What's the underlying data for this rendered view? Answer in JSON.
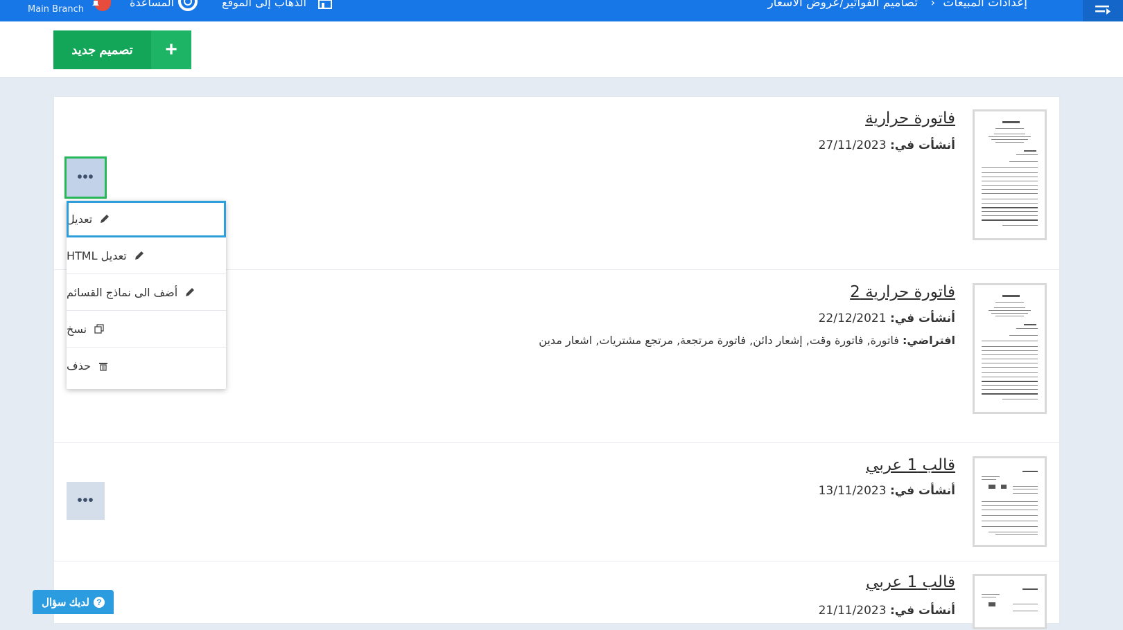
{
  "topbar": {
    "breadcrumb_parent": "إعدادات المبيعات",
    "breadcrumb_separator": "›",
    "breadcrumb_current": "تصاميم الفواتير/عروض الأسعار",
    "visit_site": "الذهاب إلى الموقع",
    "help": "المساعدة",
    "branch": "Main Branch",
    "icons": {
      "menu": "menu-toggle-icon",
      "store": "store-icon",
      "help": "lifebuoy-icon",
      "bell": "bell-icon"
    },
    "color": "#1877e6"
  },
  "actions": {
    "new_design_label": "تصميم جديد",
    "new_design_plus": "+",
    "color": "#13a659"
  },
  "templates": [
    {
      "title": "فاتورة حرارية",
      "created_label": "أنشأت في:",
      "created_date": "27/11/2023",
      "defaults_label": "",
      "defaults": ""
    },
    {
      "title": "فاتورة حرارية 2",
      "created_label": "أنشأت في:",
      "created_date": "22/12/2021",
      "defaults_label": "افتراضي:",
      "defaults": "فاتورة, فاتورة وقت, إشعار دائن, فاتورة مرتجعة, مرتجع مشتريات, اشعار مدين"
    },
    {
      "title": "قالب 1 عربي",
      "created_label": "أنشأت في:",
      "created_date": "13/11/2023",
      "defaults_label": "",
      "defaults": ""
    },
    {
      "title": "قالب 1 عربي",
      "created_label": "أنشأت في:",
      "created_date": "21/11/2023",
      "defaults_label": "",
      "defaults": ""
    }
  ],
  "more_button_label": "•••",
  "dropdown": {
    "items": [
      {
        "label": "تعديل",
        "icon": "pencil-icon"
      },
      {
        "label": "تعديل HTML",
        "icon": "pencil-icon"
      },
      {
        "label": "أضف الى نماذج القسائم",
        "icon": "pencil-icon"
      },
      {
        "label": "نسخ",
        "icon": "copy-icon"
      },
      {
        "label": "حذف",
        "icon": "trash-icon"
      }
    ]
  },
  "help_button": {
    "label": "لديك سؤال",
    "icon": "question-icon",
    "color": "#2b9ce0"
  }
}
